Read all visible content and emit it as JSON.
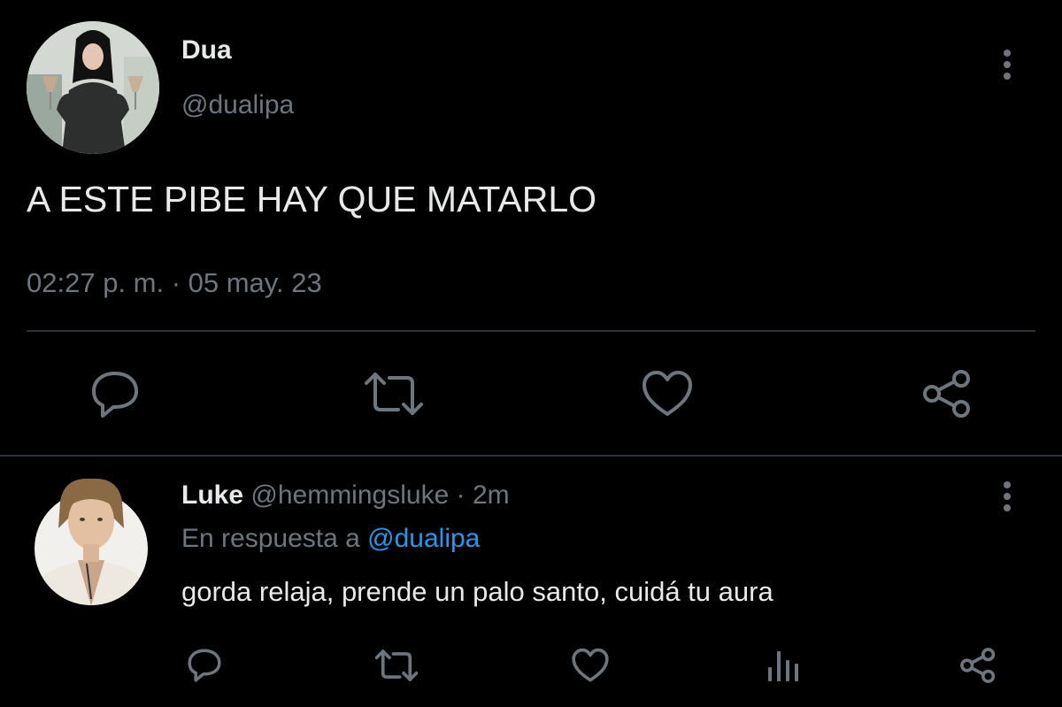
{
  "main_tweet": {
    "display_name": "Dua",
    "handle": "@dualipa",
    "text": "A ESTE PIBE HAY QUE MATARLO",
    "timestamp": "02:27 p. m. · 05 may. 23",
    "menu_icon": "more-vertical-icon",
    "actions": [
      {
        "name": "reply",
        "icon": "reply-icon"
      },
      {
        "name": "retweet",
        "icon": "retweet-icon"
      },
      {
        "name": "like",
        "icon": "heart-icon"
      },
      {
        "name": "share",
        "icon": "share-icon"
      }
    ]
  },
  "reply": {
    "display_name": "Luke",
    "handle": "@hemmingsluke",
    "separator": "·",
    "age": "2m",
    "replying_prefix": "En respuesta a",
    "replying_to": "@dualipa",
    "text": "gorda relaja, prende un palo santo, cuidá tu aura",
    "menu_icon": "more-vertical-icon",
    "actions": [
      {
        "name": "reply",
        "icon": "reply-icon"
      },
      {
        "name": "retweet",
        "icon": "retweet-icon"
      },
      {
        "name": "like",
        "icon": "heart-icon"
      },
      {
        "name": "analytics",
        "icon": "analytics-icon"
      },
      {
        "name": "share",
        "icon": "share-icon"
      }
    ]
  },
  "colors": {
    "background": "#000000",
    "text": "#e7e9ea",
    "muted": "#6e767d",
    "link": "#1d9bf0",
    "divider": "#2f3336"
  }
}
